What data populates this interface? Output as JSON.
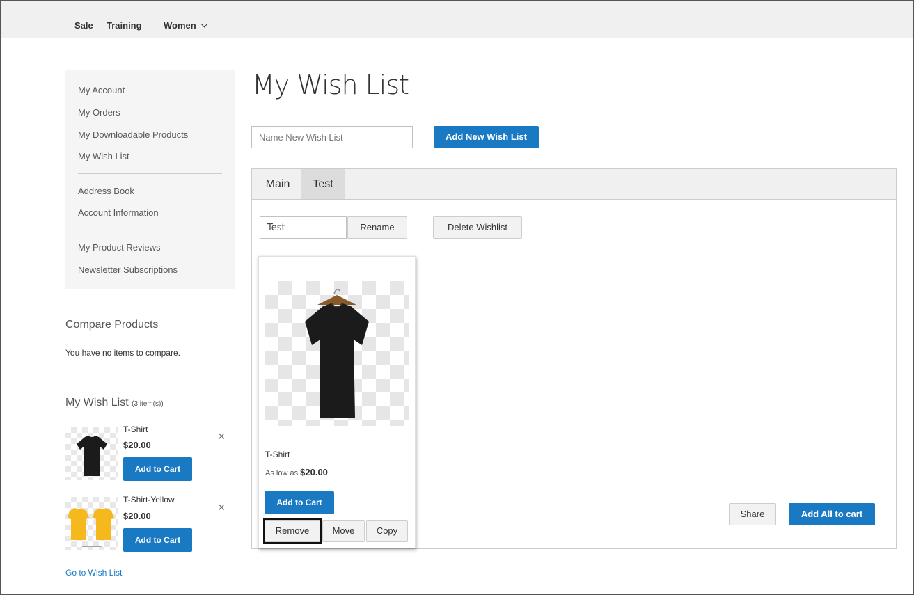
{
  "nav": {
    "items": [
      "Sale",
      "Training",
      "Women"
    ]
  },
  "account_nav": {
    "group1": [
      "My Account",
      "My Orders",
      "My Downloadable Products",
      "My Wish List"
    ],
    "group2": [
      "Address Book",
      "Account Information"
    ],
    "group3": [
      "My Product Reviews",
      "Newsletter Subscriptions"
    ]
  },
  "compare": {
    "title": "Compare Products",
    "empty_text": "You have no items to compare."
  },
  "sidebar_wishlist": {
    "title": "My Wish List",
    "count": "(3 item(s))",
    "items": [
      {
        "name": "T-Shirt",
        "price": "$20.00",
        "button": "Add to Cart",
        "remove": "×"
      },
      {
        "name": "T-Shirt-Yellow",
        "price": "$20.00",
        "button": "Add to Cart",
        "remove": "×"
      }
    ],
    "go_link": "Go to Wish List"
  },
  "main": {
    "title": "My Wish List",
    "new_list": {
      "placeholder": "Name New Wish List",
      "button": "Add New Wish List"
    },
    "tabs": [
      {
        "label": "Main",
        "active": false
      },
      {
        "label": "Test",
        "active": true
      }
    ],
    "list_controls": {
      "name_value": "Test",
      "rename": "Rename",
      "delete": "Delete Wishlist"
    },
    "product": {
      "name": "T-Shirt",
      "price_prefix": "As low as",
      "price": "$20.00",
      "add_to_cart": "Add to Cart",
      "remove": "Remove",
      "move": "Move",
      "copy": "Copy"
    },
    "share": "Share",
    "add_all": "Add All to cart"
  },
  "colors": {
    "primary": "#1979c3",
    "nav_bg": "#f0f0f0",
    "sidebar_bg": "#f5f5f5",
    "shirt_black": "#1b1b1b",
    "shirt_yellow": "#f5b81d"
  },
  "icons": {
    "close": "close-icon",
    "chevron": "chevron-down-icon"
  }
}
